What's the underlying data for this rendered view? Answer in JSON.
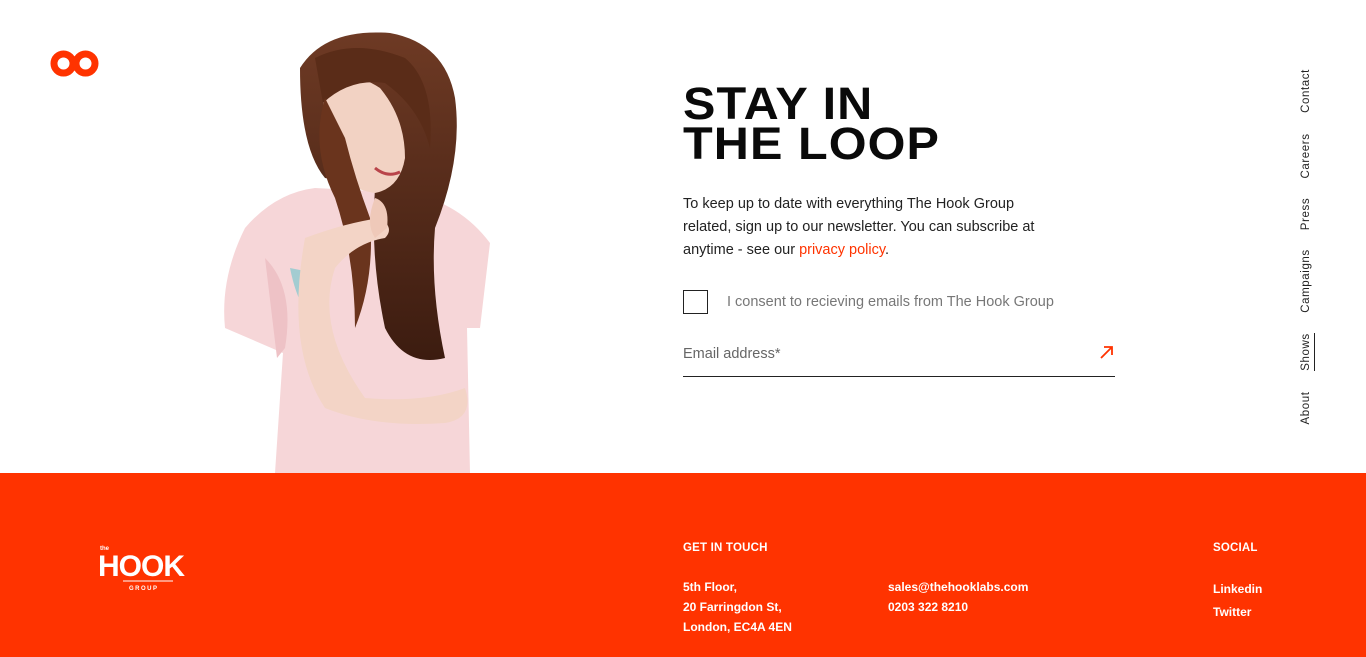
{
  "brand": {
    "logo_icon": "infinity-loop-icon",
    "accent_color": "#ff3300"
  },
  "hero": {
    "image": "smiling-woman-pink-tshirt-photo",
    "headline_line1": "STAY IN",
    "headline_line2": "THE LOOP",
    "intro_text": "To keep up to date with everything The Hook Group related, sign up to our newsletter. You can subscribe at anytime - see our ",
    "privacy_link": "privacy policy",
    "intro_end": "."
  },
  "form": {
    "consent_label": "I consent to recieving emails from The Hook Group",
    "consent_checked": false,
    "email_placeholder": "Email address*",
    "email_value": "",
    "submit_icon": "arrow-up-right-icon"
  },
  "side_nav": {
    "items": [
      "Contact",
      "Careers",
      "Press",
      "Campaigns",
      "Shows",
      "About"
    ],
    "active": "Shows"
  },
  "footer": {
    "logo": {
      "small_top": "the",
      "word": "HOOK",
      "sub": "GROUP"
    },
    "get_in_touch": {
      "heading": "GET IN TOUCH",
      "address": [
        "5th Floor,",
        "20 Farringdon St,",
        "London, EC4A 4EN"
      ],
      "email": "sales@thehooklabs.com",
      "phone": "0203 322 8210"
    },
    "social": {
      "heading": "SOCIAL",
      "links": [
        "Linkedin",
        "Twitter"
      ]
    }
  }
}
